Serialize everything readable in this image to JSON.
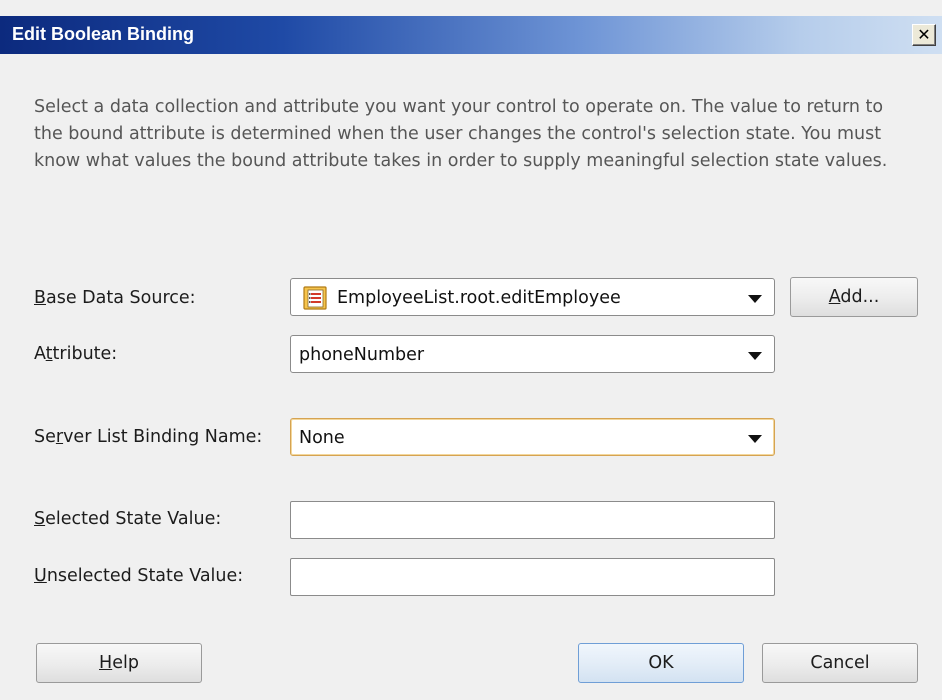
{
  "dialog": {
    "title": "Edit Boolean Binding",
    "close_glyph": "✕",
    "instructions": "Select a data collection and attribute you want your control to operate on. The value to return to the bound attribute is determined when the user changes the control's selection state. You must know what values the bound attribute takes in order to supply meaningful selection state values."
  },
  "base_data_source": {
    "label_pre": "",
    "label_mnemonic": "B",
    "label_post": "ase Data Source:",
    "value": "EmployeeList.root.editEmployee",
    "icon": "data-control-icon",
    "add_pre": "",
    "add_mnemonic": "A",
    "add_post": "dd..."
  },
  "attribute": {
    "label_pre": "A",
    "label_mnemonic": "t",
    "label_post": "tribute:",
    "value": "phoneNumber"
  },
  "server_list": {
    "label_pre": "Se",
    "label_mnemonic": "r",
    "label_post": "ver List Binding Name:",
    "value": "None"
  },
  "selected_state": {
    "label_pre": "",
    "label_mnemonic": "S",
    "label_post": "elected State Value:",
    "value": ""
  },
  "unselected_state": {
    "label_pre": "",
    "label_mnemonic": "U",
    "label_post": "nselected State Value:",
    "value": ""
  },
  "buttons": {
    "help_pre": "",
    "help_mnemonic": "H",
    "help_post": "elp",
    "ok": "OK",
    "cancel": "Cancel"
  },
  "colors": {
    "titlebar_start": "#0c2a7e",
    "titlebar_end": "#cfdff2",
    "focus_border": "#d5a352"
  }
}
